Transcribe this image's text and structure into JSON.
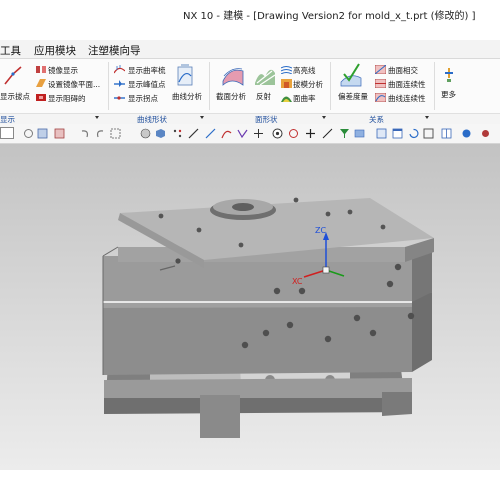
{
  "window": {
    "title": "NX 10 - 建模 - [Drawing Version2 for mold_x_t.prt  (修改的)  ]"
  },
  "menu": {
    "items": [
      "工具",
      "应用模块",
      "注塑模向导"
    ]
  },
  "ribbon": {
    "display_group": {
      "big_label": "显示拔点",
      "items": [
        "镜像显示",
        "设置镜像平面...",
        "显示阻碍的"
      ]
    },
    "curve_shape_group": {
      "items": [
        "显示曲率梳",
        "显示峰值点",
        "显示拐点"
      ],
      "big_label": "曲线分析"
    },
    "face_shape_group": {
      "big_labels": [
        "截面分析",
        "反射"
      ],
      "items": [
        "高亮线",
        "拔模分析",
        "面曲率"
      ]
    },
    "relation_group": {
      "big_label": "偏差度量",
      "items": [
        "曲面相交",
        "曲面连续性",
        "曲线连续性"
      ]
    },
    "more_label": "更多",
    "group_labels": {
      "display": "显示",
      "curve_shape": "曲线形状",
      "face_shape": "面形状",
      "relation": "关系"
    }
  },
  "viewport": {
    "axis_label_zc": "ZC",
    "axis_label_xc": "XC"
  },
  "colors": {
    "menubar_bg": "#f3f3f3",
    "viewport_top": "#c3c3c3",
    "viewport_bottom": "#ececec",
    "group_label": "#1f4e9c",
    "axis_z": "#1e4fd8",
    "axis_x": "#d02020",
    "axis_y": "#1a9a1a"
  },
  "icons": [
    "polyline-icon",
    "mirror-display-icon",
    "mirror-plane-icon",
    "blocked-icon",
    "curvature-comb-icon",
    "peak-point-icon",
    "inflection-icon",
    "curve-analysis-icon",
    "section-analysis-icon",
    "reflection-icon",
    "highlight-lines-icon",
    "draft-analysis-icon",
    "face-curvature-icon",
    "deviation-icon",
    "surface-intersect-icon",
    "surface-continuity-icon",
    "curve-continuity-icon",
    "more-icon"
  ]
}
